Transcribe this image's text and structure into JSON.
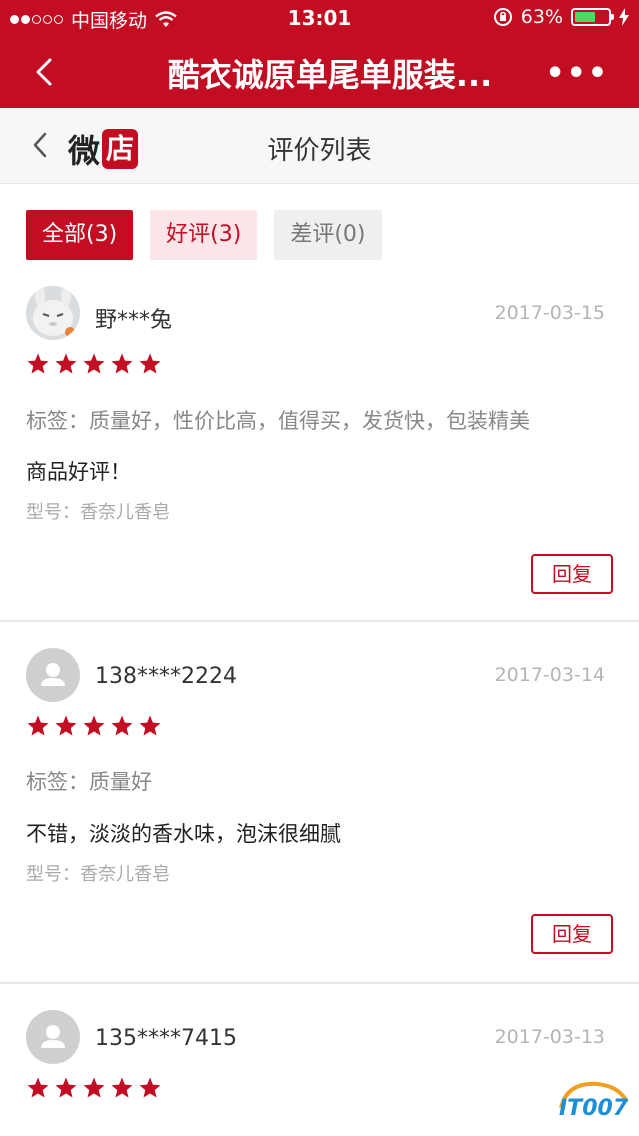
{
  "status_bar": {
    "carrier": "中国移动",
    "time": "13:01",
    "battery_percent": "63%",
    "battery_level": 0.63
  },
  "nav": {
    "title": "酷衣诚原单尾单服装...",
    "more": "•••"
  },
  "sub_header": {
    "brand_char1": "微",
    "brand_char2": "店",
    "title": "评价列表"
  },
  "filters": [
    {
      "label": "全部(3)"
    },
    {
      "label": "好评(3)"
    },
    {
      "label": "差评(0)"
    }
  ],
  "reviews": [
    {
      "user": "野***兔",
      "date": "2017-03-15",
      "rating": 5,
      "tags": "标签：质量好，性价比高，值得买，发货快，包装精美",
      "content": "商品好评！",
      "model": "型号：香奈儿香皂",
      "reply_label": "回复"
    },
    {
      "user": "138****2224",
      "date": "2017-03-14",
      "rating": 5,
      "tags": "标签：质量好",
      "content": "不错，淡淡的香水味，泡沫很细腻",
      "model": "型号：香奈儿香皂",
      "reply_label": "回复"
    },
    {
      "user": "135****7415",
      "date": "2017-03-13",
      "rating": 5
    }
  ],
  "watermark": {
    "text": "IT007"
  },
  "colors": {
    "brand_red": "#c20d23",
    "star": "#c20d23",
    "battery_green": "#4cd964"
  }
}
